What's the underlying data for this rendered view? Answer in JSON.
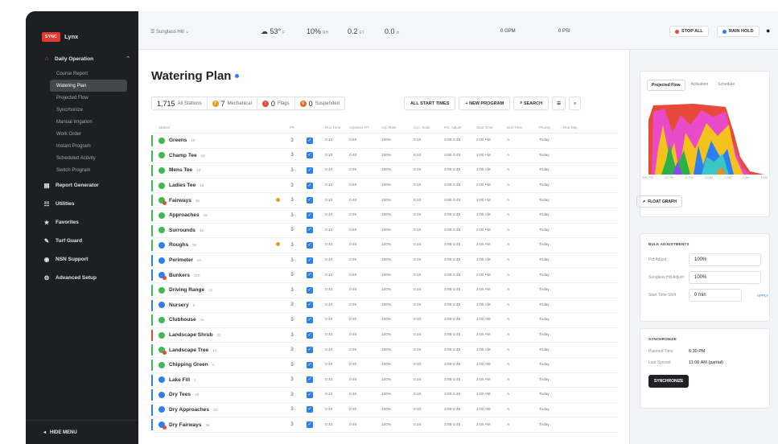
{
  "sidebar": {
    "brand_badge": "SYNC",
    "brand_name": "Lynx",
    "group_label": "Daily Operation",
    "sub_items": [
      {
        "label": "Course Report",
        "active": false
      },
      {
        "label": "Watering Plan",
        "active": true
      },
      {
        "label": "Projected Flow",
        "active": false
      },
      {
        "label": "Syncrhonize",
        "active": false
      },
      {
        "label": "Manual Irrigation",
        "active": false
      },
      {
        "label": "Work Order",
        "active": false
      },
      {
        "label": "Instant Program",
        "active": false
      },
      {
        "label": "Scheduled Activity",
        "active": false
      },
      {
        "label": "Switch Program",
        "active": false
      }
    ],
    "items": [
      {
        "label": "Report Generator",
        "icon": "report-icon",
        "glyph": "▤"
      },
      {
        "label": "Utilities",
        "icon": "utilities-icon",
        "glyph": "☷"
      },
      {
        "label": "Favorites",
        "icon": "star-icon",
        "glyph": "★"
      },
      {
        "label": "Turf Guard",
        "icon": "turf-guard-icon",
        "glyph": "✎"
      },
      {
        "label": "NSN Support",
        "icon": "support-icon",
        "glyph": "◉"
      },
      {
        "label": "Advanced Setup",
        "icon": "gear-icon",
        "glyph": "⚙"
      }
    ],
    "hide_menu": "HIDE MENU"
  },
  "topbar": {
    "station": "Sunglass Hill",
    "weather": [
      {
        "value": "53°",
        "unit": "F"
      },
      {
        "value": "10%",
        "unit": "RH"
      },
      {
        "value": "0.2",
        "unit": "ET"
      },
      {
        "value": "0.0",
        "unit": "in"
      }
    ],
    "flow": "0 GPM",
    "pressure": "0 PSI",
    "stop_all": "STOP ALL",
    "rain_hold": "RAIN HOLD"
  },
  "page": {
    "title": "Watering Plan",
    "stats": [
      {
        "value": "1,715",
        "label": "All Stations",
        "badge": "",
        "color": ""
      },
      {
        "value": "7",
        "label": "Mechanical",
        "badge": "7",
        "color": "#f39a1c"
      },
      {
        "value": "0",
        "label": "Flags",
        "badge": "!",
        "color": "#e24a3a"
      },
      {
        "value": "0",
        "label": "Suspended",
        "badge": "0",
        "color": "#e86a1c"
      }
    ],
    "actions": {
      "all_start": "ALL START TIMES",
      "new_program": "+ NEW PROGRAM",
      "search": "SEARCH"
    }
  },
  "table": {
    "headers": [
      "Station",
      "",
      "PR",
      "",
      "Run Time",
      "Adjusted RT",
      "Adj. Rate",
      "Cyc. Soak",
      "Pct. Adjust",
      "Start Time",
      "End Time",
      "Priority",
      "Run Day"
    ],
    "rows": [
      {
        "name": "Greens",
        "sub": "18",
        "status": "#3fb950",
        "multi": false,
        "stripe": "#3fb950",
        "flag": false,
        "pr": "3"
      },
      {
        "name": "Champ Tee",
        "sub": "18",
        "status": "#3fb950",
        "multi": false,
        "stripe": "#3fb950",
        "flag": false,
        "pr": "3"
      },
      {
        "name": "Mens Tee",
        "sub": "18",
        "status": "#3fb950",
        "multi": false,
        "stripe": "#3fb950",
        "flag": false,
        "pr": "3"
      },
      {
        "name": "Ladies Tee",
        "sub": "18",
        "status": "#3fb950",
        "multi": false,
        "stripe": "#3fb950",
        "flag": false,
        "pr": "3"
      },
      {
        "name": "Fairways",
        "sub": "36",
        "status": "#3fb950",
        "multi": true,
        "stripe": "#3fb950",
        "flag": true,
        "pr": "3"
      },
      {
        "name": "Approaches",
        "sub": "18",
        "status": "#3fb950",
        "multi": false,
        "stripe": "#3fb950",
        "flag": false,
        "pr": "3"
      },
      {
        "name": "Surrounds",
        "sub": "18",
        "status": "#3fb950",
        "multi": false,
        "stripe": "#3fb950",
        "flag": false,
        "pr": "3"
      },
      {
        "name": "Roughs",
        "sub": "54",
        "status": "#2b7ff0",
        "multi": false,
        "stripe": "#3fb950",
        "flag": true,
        "pr": "3"
      },
      {
        "name": "Perimeter",
        "sub": "24",
        "status": "#2b7ff0",
        "multi": false,
        "stripe": "#2b7ff0",
        "flag": false,
        "pr": "3"
      },
      {
        "name": "Bunkers",
        "sub": "120",
        "status": "#2b7ff0",
        "multi": true,
        "stripe": "#2b7ff0",
        "flag": false,
        "pr": "3"
      },
      {
        "name": "Driving Range",
        "sub": "12",
        "status": "#3fb950",
        "multi": false,
        "stripe": "#3fb950",
        "flag": false,
        "pr": "3"
      },
      {
        "name": "Nursery",
        "sub": "8",
        "status": "#2b7ff0",
        "multi": false,
        "stripe": "#2b7ff0",
        "flag": false,
        "pr": "3"
      },
      {
        "name": "Clubhouse",
        "sub": "16",
        "status": "#3fb950",
        "multi": false,
        "stripe": "#3fb950",
        "flag": false,
        "pr": "3"
      },
      {
        "name": "Landscape Shrub",
        "sub": "22",
        "status": "#3fb950",
        "multi": false,
        "stripe": "#e24a3a",
        "flag": false,
        "pr": "3"
      },
      {
        "name": "Landscape Tree",
        "sub": "14",
        "status": "#3fb950",
        "multi": true,
        "stripe": "#3fb950",
        "flag": false,
        "pr": "3"
      },
      {
        "name": "Chipping Green",
        "sub": "4",
        "status": "#3fb950",
        "multi": false,
        "stripe": "#3fb950",
        "flag": false,
        "pr": "3"
      },
      {
        "name": "Lake Fill",
        "sub": "1",
        "status": "#2b7ff0",
        "multi": false,
        "stripe": "#2b7ff0",
        "flag": false,
        "pr": "3"
      },
      {
        "name": "Dry Tees",
        "sub": "18",
        "status": "#2b7ff0",
        "multi": false,
        "stripe": "#2b7ff0",
        "flag": false,
        "pr": "3"
      },
      {
        "name": "Dry Approaches",
        "sub": "18",
        "status": "#2b7ff0",
        "multi": false,
        "stripe": "#2b7ff0",
        "flag": false,
        "pr": "3"
      },
      {
        "name": "Dry Fairways",
        "sub": "36",
        "status": "#2b7ff0",
        "multi": true,
        "stripe": "#2b7ff0",
        "flag": false,
        "pr": "3"
      }
    ],
    "cell_values": [
      "0:10",
      "0:40",
      "100%",
      "0:10",
      "3:00-3:45",
      "2:00 AM",
      "A",
      "Today"
    ]
  },
  "panel": {
    "tabs": [
      "Projected Flow",
      "Activation",
      "Schedule"
    ],
    "graph_axis": [
      "9:00 PM",
      "10 PM",
      "11 PM",
      "12 AM",
      "1 AM",
      "2 AM",
      "3 AM"
    ],
    "float_graph": "FLOAT GRAPH",
    "bulk_title": "BULK ADJUSTMENTS",
    "bulk": [
      {
        "label": "Pct Adjust",
        "value": "100%",
        "apply": ""
      },
      {
        "label": "Sunglass Hill Adjust",
        "value": "100%",
        "apply": ""
      },
      {
        "label": "Start Time Shift",
        "value": "0 min",
        "apply": "APPLY"
      }
    ],
    "sync_title": "SYNCHRONIZE",
    "sync": [
      {
        "label": "Planned Time",
        "value": "6:30 PM"
      },
      {
        "label": "Last Synced",
        "value": "11:00 AM (partial)"
      }
    ],
    "sync_button": "SYNCHRONIZE"
  },
  "colors": {
    "accent": "#2b7ff0",
    "green": "#3fb950",
    "red": "#e24a3a",
    "orange": "#f39a1c"
  }
}
